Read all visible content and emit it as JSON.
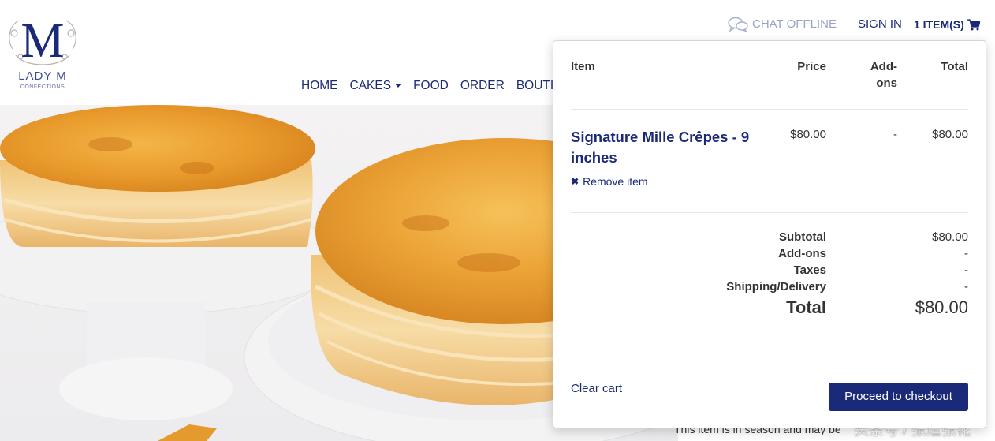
{
  "brand": {
    "logo_letter": "M",
    "name": "LADY M",
    "tagline": "CONFECTIONS"
  },
  "topbar": {
    "chat_label": "CHAT OFFLINE",
    "chat_icon": "speech-bubbles-icon",
    "signin_label": "SIGN IN",
    "cart_label": "1 ITEM(S)",
    "cart_icon": "shopping-cart-icon"
  },
  "nav": {
    "items": [
      {
        "label": "HOME"
      },
      {
        "label": "CAKES",
        "has_dropdown": true
      },
      {
        "label": "FOOD"
      },
      {
        "label": "ORDER"
      },
      {
        "label": "BOUTIQ"
      }
    ]
  },
  "cart": {
    "columns": {
      "item": "Item",
      "price": "Price",
      "addons_line1": "Add-",
      "addons_line2": "ons",
      "total": "Total"
    },
    "items": [
      {
        "name": "Signature Mille Crêpes - 9 inches",
        "price": "$80.00",
        "addons": "-",
        "total": "$80.00",
        "remove_label": "Remove item"
      }
    ],
    "summary": {
      "subtotal_label": "Subtotal",
      "subtotal_value": "$80.00",
      "addons_label": "Add-ons",
      "addons_value": "-",
      "taxes_label": "Taxes",
      "taxes_value": "-",
      "shipping_label": "Shipping/Delivery",
      "shipping_value": "-",
      "total_label": "Total",
      "total_value": "$80.00"
    },
    "clear_label": "Clear cart",
    "checkout_label": "Proceed to checkout"
  },
  "page": {
    "partial_text": "This item is in season and may be"
  },
  "watermark": "头条号 / 张逗张花",
  "colors": {
    "brand_navy": "#1b2a78",
    "muted_blue": "#9aa2c7",
    "text_dark": "#333333"
  }
}
